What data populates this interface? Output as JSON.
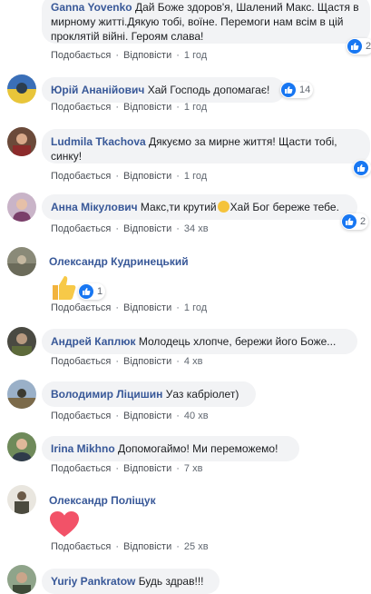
{
  "actions": {
    "like": "Подобається",
    "reply": "Відповісти",
    "dot": "·"
  },
  "comments": [
    {
      "author": "Ganna Yovenko",
      "text": "Дай Боже здоров'я, Шалений Макс. Щастя в мирному житті.Дякую тобі, воїне. Перемоги нам всім в цій проклятій війні. Героям слава!",
      "time": "1 год",
      "reactions": "2"
    },
    {
      "author": "Юрій Ананійович",
      "text": "Хай Господь допомагає!",
      "time": "1 год",
      "reactions": "14"
    },
    {
      "author": "Ludmila Tkachova",
      "text": "Дякуємо за мирне життя! Щасти тобі, синку!",
      "time": "1 год",
      "reactions": ""
    },
    {
      "author": "Анна Мікулович",
      "text": "Макс,ти крутий",
      "text2": "Хай Бог береже тебе.",
      "time": "34 хв",
      "reactions": "2"
    },
    {
      "author": "Олександр Кудринецький",
      "text": "",
      "time": "1 год",
      "reactions": "1"
    },
    {
      "author": "Андрей Каплюк",
      "text": "Молодець хлопче, бережи його Боже...",
      "time": "4 хв",
      "reactions": ""
    },
    {
      "author": "Володимир Ліцишин",
      "text": "Уаз кабріолет)",
      "time": "40 хв",
      "reactions": ""
    },
    {
      "author": "Irina Mikhno",
      "text": "Допомогаймо! Ми переможемо!",
      "time": "7 хв",
      "reactions": ""
    },
    {
      "author": "Олександр Поліщук",
      "text": "",
      "time": "25 хв",
      "reactions": ""
    },
    {
      "author": "Yuriy Pankratow",
      "text": "Будь здрав!!!",
      "time": "",
      "reactions": ""
    }
  ],
  "colors": {
    "name": "#385898",
    "bubble": "#f2f3f5",
    "like": "#1877f2"
  }
}
